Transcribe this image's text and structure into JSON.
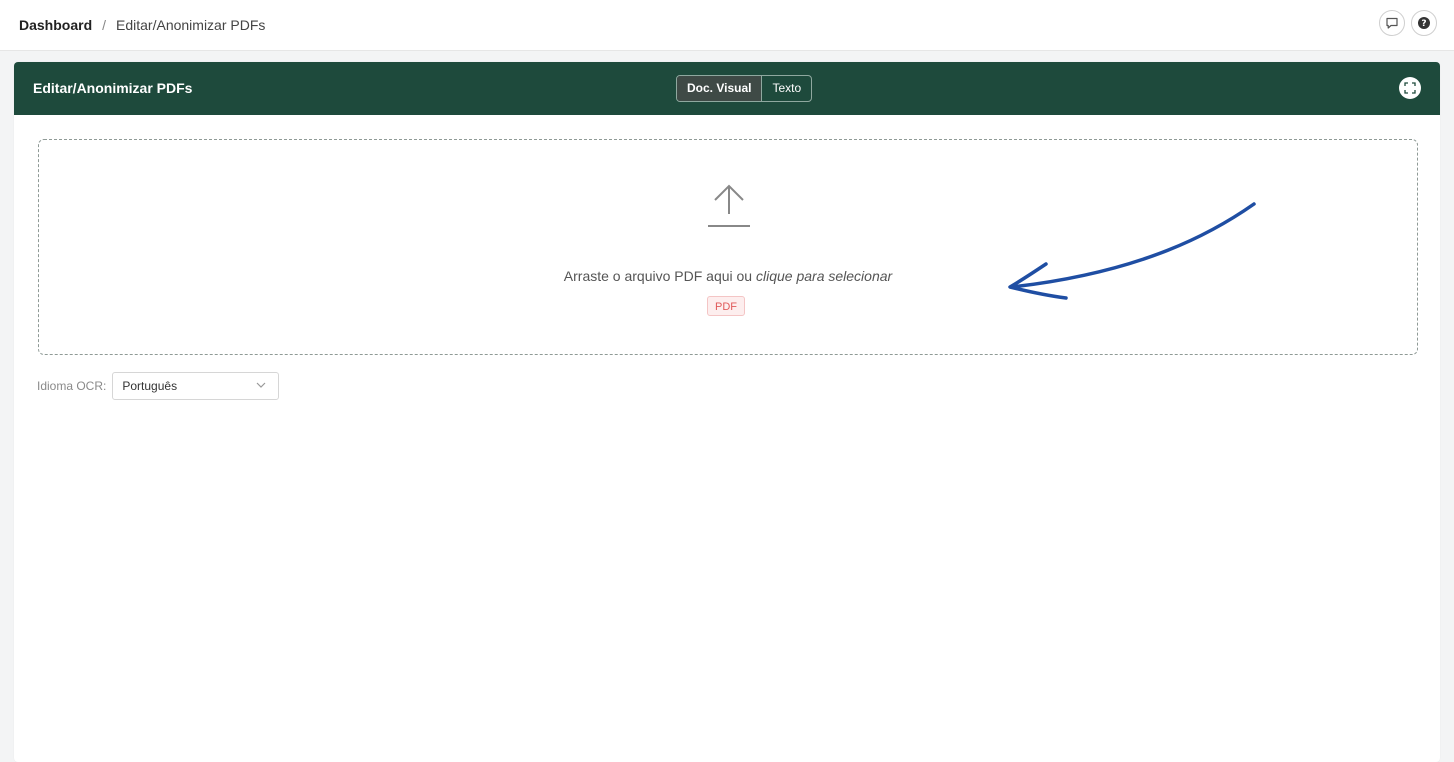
{
  "breadcrumb": {
    "root": "Dashboard",
    "separator": "/",
    "current": "Editar/Anonimizar PDFs"
  },
  "top_icons": [
    "chat-icon",
    "help-icon"
  ],
  "card": {
    "title": "Editar/Anonimizar PDFs",
    "tabs": [
      {
        "label": "Doc. Visual",
        "active": true
      },
      {
        "label": "Texto",
        "active": false
      }
    ],
    "fullscreen_icon": "fullscreen-icon",
    "header_color": "#1e4a3c"
  },
  "dropzone": {
    "text_plain": "Arraste o arquivo PDF aqui ou ",
    "text_em": "clique para selecionar",
    "badge": "PDF",
    "icon": "upload-icon"
  },
  "ocr": {
    "label": "Idioma OCR:",
    "selected": "Português"
  },
  "annotation": {
    "type": "hand-drawn-arrow",
    "color": "#1f4ea3"
  }
}
